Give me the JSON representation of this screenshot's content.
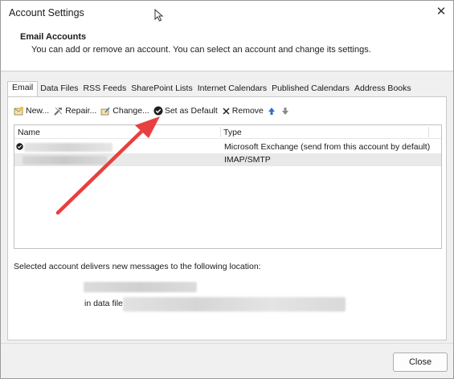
{
  "window": {
    "title": "Account Settings",
    "close_glyph": "✕"
  },
  "header": {
    "title": "Email Accounts",
    "description": "You can add or remove an account. You can select an account and change its settings."
  },
  "tabs": [
    {
      "label": "Email",
      "active": true
    },
    {
      "label": "Data Files"
    },
    {
      "label": "RSS Feeds"
    },
    {
      "label": "SharePoint Lists"
    },
    {
      "label": "Internet Calendars"
    },
    {
      "label": "Published Calendars"
    },
    {
      "label": "Address Books"
    }
  ],
  "toolbar": {
    "new_label": "New...",
    "repair_label": "Repair...",
    "change_label": "Change...",
    "set_default_label": "Set as Default",
    "remove_label": "Remove",
    "icons": [
      "new-icon",
      "repair-icon",
      "change-icon",
      "checkmark-circle-icon",
      "remove-x-icon",
      "arrow-up-icon",
      "arrow-down-icon"
    ]
  },
  "accounts": {
    "columns": {
      "name": "Name",
      "type": "Type"
    },
    "rows": [
      {
        "type": "Microsoft Exchange (send from this account by default)",
        "is_default": true
      },
      {
        "type": "IMAP/SMTP",
        "is_default": false,
        "selected": true
      }
    ]
  },
  "delivery": {
    "text": "Selected account delivers new messages to the following location:",
    "data_file_label": "in data file"
  },
  "footer": {
    "close_label": "Close"
  },
  "colors": {
    "annotation_arrow": "#e8403e",
    "selected_row": "#e9e9e9",
    "up_arrow": "#2f6fc9"
  }
}
